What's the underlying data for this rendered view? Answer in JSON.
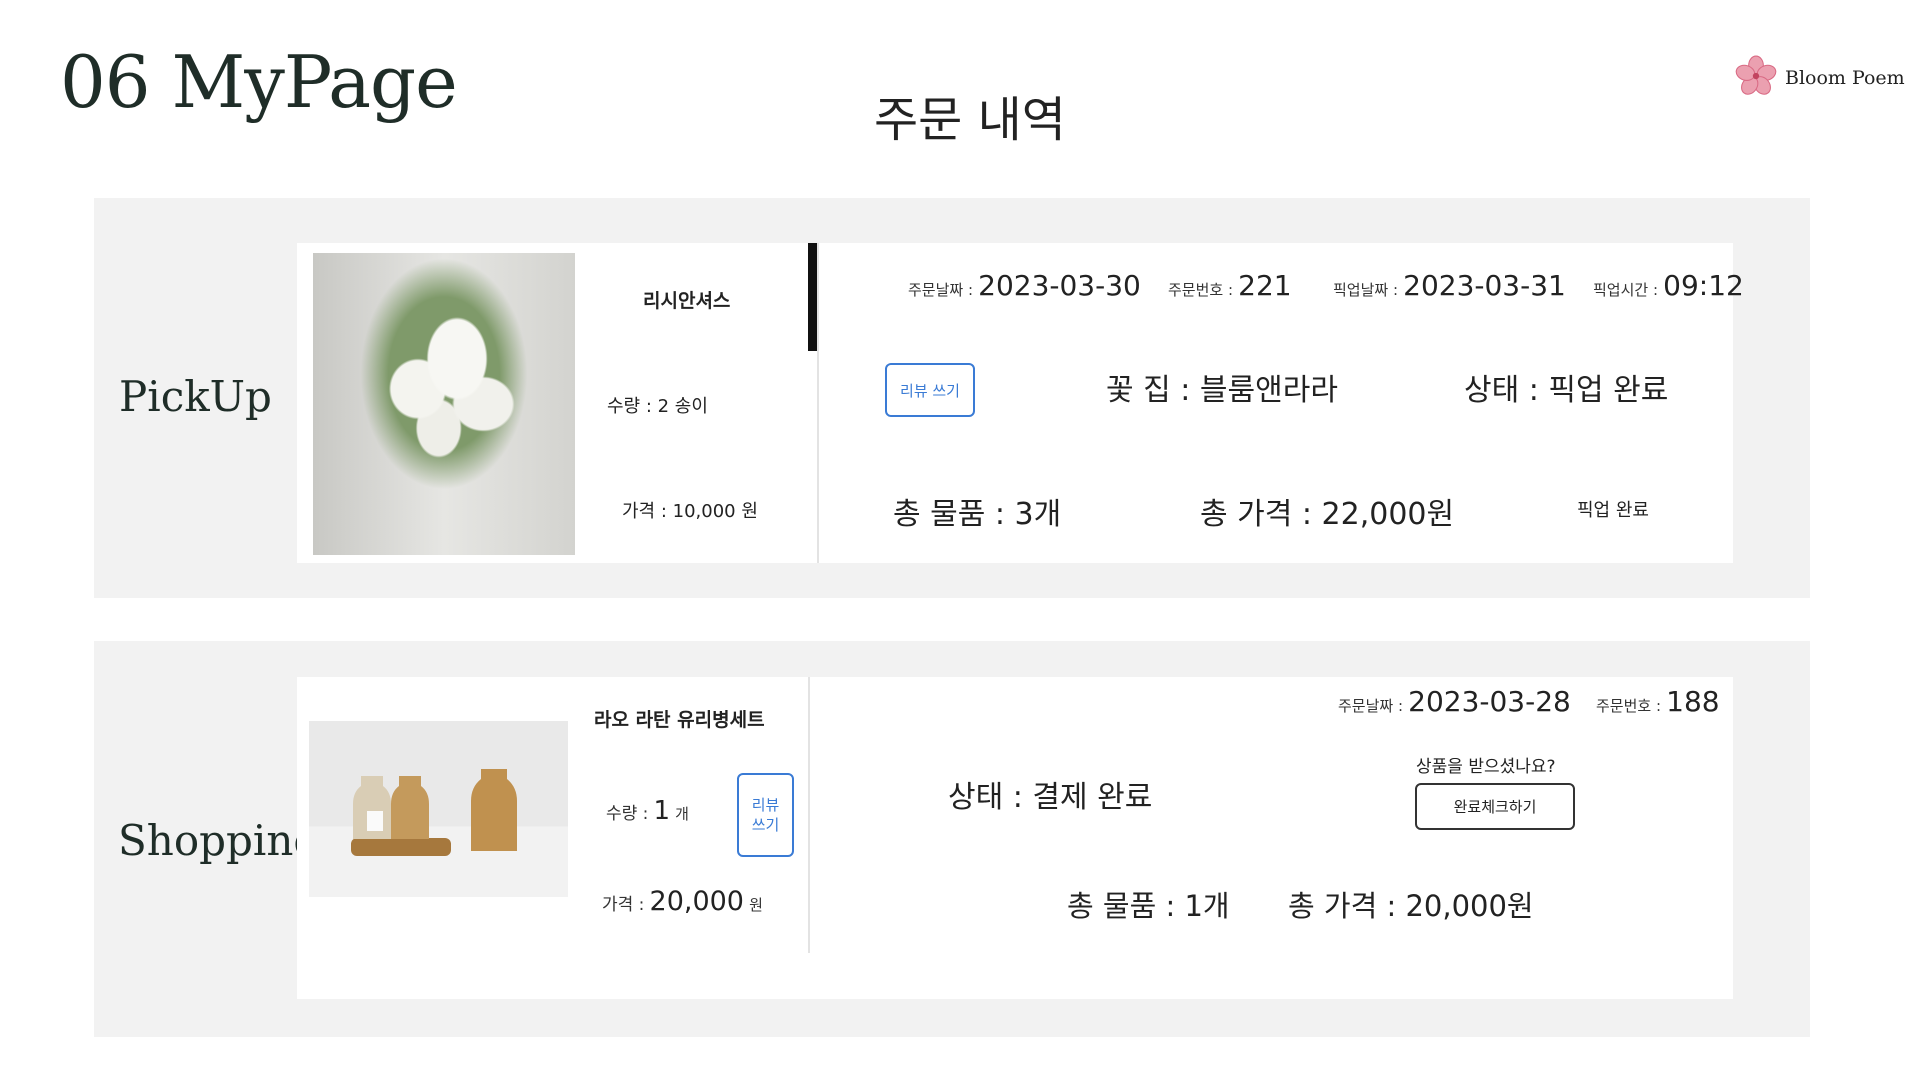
{
  "header": {
    "page_heading": "06 MyPage",
    "section_title": "주문 내역",
    "brand_name": "Bloom Poem",
    "brand_icon": "hibiscus-flower-icon",
    "brand_color": "#e8839a"
  },
  "pickup": {
    "row_label": "PickUp",
    "product_name": "리시안셔스",
    "quantity": "수량 : 2 송이",
    "price": "가격 : 10,000 원",
    "order_date_label": "주문날짜 :",
    "order_date": "2023-03-30",
    "order_no_label": "주문번호 :",
    "order_no": "221",
    "pickup_date_label": "픽업날짜 :",
    "pickup_date": "2023-03-31",
    "pickup_time_label": "픽업시간 :",
    "pickup_time": "09:12",
    "review_button": "리뷰 쓰기",
    "shop": "꽃 집 : 블룸앤라라",
    "status": "상태 : 픽업 완료",
    "total_items": "총 물품 : 3개",
    "total_price": "총 가격 : 22,000원",
    "pickup_status_note": "픽업 완료"
  },
  "shopping": {
    "row_label": "Shopping",
    "product_name": "라오 라탄 유리병세트",
    "quantity_label": "수량 :",
    "quantity_value": "1",
    "quantity_unit": "개",
    "price_label": "가격 :",
    "price_value": "20,000",
    "price_unit": "원",
    "review_button_line1": "리뷰",
    "review_button_line2": "쓰기",
    "order_date_label": "주문날짜 :",
    "order_date": "2023-03-28",
    "order_no_label": "주문번호 :",
    "order_no": "188",
    "status": "상태 : 결제 완료",
    "received_question": "상품을 받으셨나요?",
    "complete_check_button": "완료체크하기",
    "total_items": "총 물품 : 1개",
    "total_price": "총 가격 : 20,000원"
  }
}
